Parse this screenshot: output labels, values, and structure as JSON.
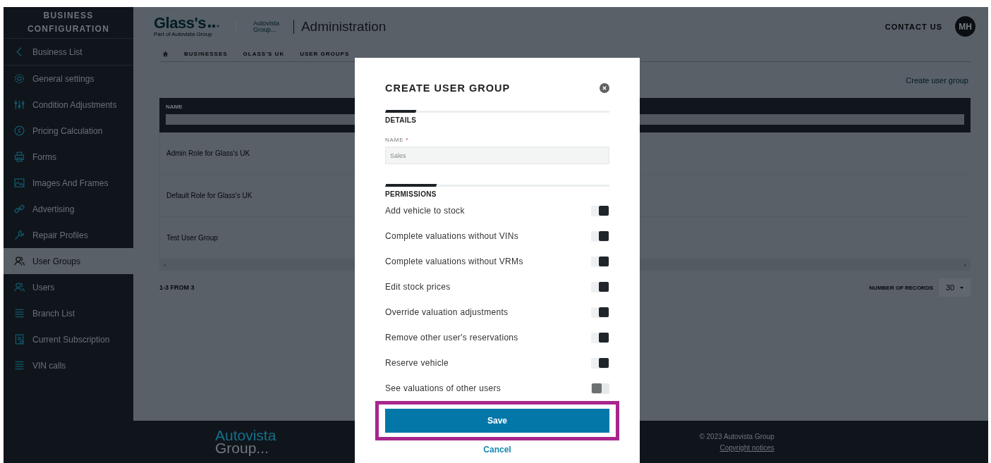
{
  "sidebar": {
    "title": "BUSINESS CONFIGURATION",
    "back_link": "Business List",
    "items": [
      {
        "label": "General settings",
        "selected": false
      },
      {
        "label": "Condition Adjustments",
        "selected": false
      },
      {
        "label": "Pricing Calculation",
        "selected": false
      },
      {
        "label": "Forms",
        "selected": false
      },
      {
        "label": "Images And Frames",
        "selected": false
      },
      {
        "label": "Advertising",
        "selected": false
      },
      {
        "label": "Repair Profiles",
        "selected": false
      },
      {
        "label": "User Groups",
        "selected": true
      },
      {
        "label": "Users",
        "selected": false
      },
      {
        "label": "Branch List",
        "selected": false
      },
      {
        "label": "Current Subscription",
        "selected": false
      },
      {
        "label": "VIN calls",
        "selected": false
      }
    ]
  },
  "header": {
    "logo": "Glass's",
    "logo_tagline": "Part of Autovista Group",
    "partner_logo": [
      "Autovista",
      "Group..."
    ],
    "title": "Administration",
    "contact": "CONTACT US",
    "avatar": "MH"
  },
  "breadcrumb": [
    "BUSINESSES",
    "GLASS'S UK",
    "USER GROUPS"
  ],
  "create_link": "Create user group",
  "table": {
    "columns": [
      "NAME"
    ],
    "rows": [
      "Admin Role for Glass's UK",
      "Default Role for Glass's UK",
      "Test User Group"
    ]
  },
  "pagination": {
    "summary": "1-3 FROM 3",
    "records_label": "NUMBER OF RECORDS",
    "records_value": "30"
  },
  "footer": {
    "logo": [
      "Autovista",
      "Group..."
    ],
    "copyright": "© 2023 Autovista Group",
    "link": "Copyright notices"
  },
  "modal": {
    "title": "CREATE USER GROUP",
    "details_heading": "DETAILS",
    "name_label": "NAME",
    "required_mark": "*",
    "name_value": "Sales",
    "permissions_heading": "PERMISSIONS",
    "permissions": [
      {
        "label": "Add vehicle to stock",
        "on": true
      },
      {
        "label": "Complete valuations without VINs",
        "on": true
      },
      {
        "label": "Complete valuations without VRMs",
        "on": true
      },
      {
        "label": "Edit stock prices",
        "on": true
      },
      {
        "label": "Override valuation adjustments",
        "on": true
      },
      {
        "label": "Remove other user's reservations",
        "on": true
      },
      {
        "label": "Reserve vehicle",
        "on": true
      },
      {
        "label": "See valuations of other users",
        "on": false
      }
    ],
    "save": "Save",
    "save_highlighted": true,
    "cancel": "Cancel"
  }
}
